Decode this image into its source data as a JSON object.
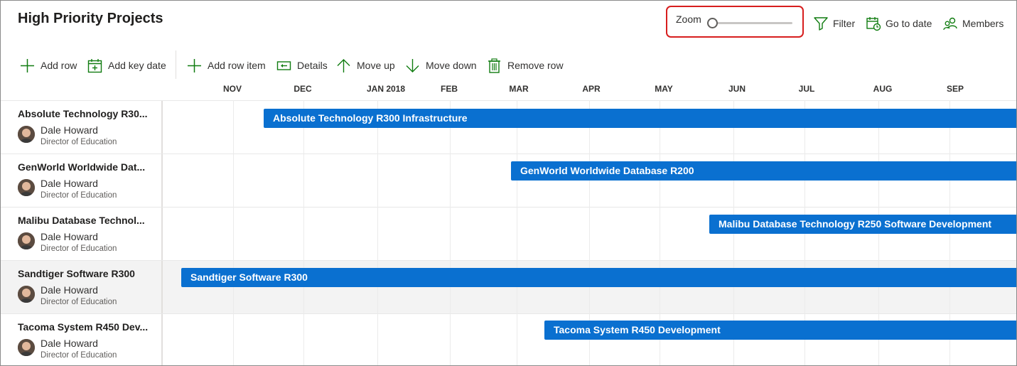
{
  "page": {
    "title": "High Priority Projects"
  },
  "zoom": {
    "label": "Zoom",
    "level": 0
  },
  "header_actions": {
    "filter": "Filter",
    "go_to_date": "Go to date",
    "members": "Members"
  },
  "toolbar": {
    "add_row": "Add row",
    "add_key_date": "Add key date",
    "add_row_item": "Add row item",
    "details": "Details",
    "move_up": "Move up",
    "move_down": "Move down",
    "remove_row": "Remove row"
  },
  "timeline": {
    "months": [
      "NOV",
      "DEC",
      "JAN 2018",
      "FEB",
      "MAR",
      "APR",
      "MAY",
      "JUN",
      "JUL",
      "AUG",
      "SEP"
    ]
  },
  "rows": [
    {
      "name": "Absolute Technology R30...",
      "person": "Dale Howard",
      "role": "Director of Education",
      "bar_label": "Absolute Technology R300 Infrastructure"
    },
    {
      "name": "GenWorld Worldwide Dat...",
      "person": "Dale Howard",
      "role": "Director of Education",
      "bar_label": "GenWorld Worldwide Database R200"
    },
    {
      "name": "Malibu Database Technol...",
      "person": "Dale Howard",
      "role": "Director of Education",
      "bar_label": "Malibu Database Technology R250 Software Development"
    },
    {
      "name": "Sandtiger Software R300",
      "person": "Dale Howard",
      "role": "Director of Education",
      "bar_label": "Sandtiger Software R300",
      "selected": true
    },
    {
      "name": "Tacoma System R450 Dev...",
      "person": "Dale Howard",
      "role": "Director of Education",
      "bar_label": "Tacoma System R450 Development"
    }
  ],
  "colors": {
    "bar": "#0a70d0",
    "zoom_highlight": "#d71e1e",
    "icon_green": "#107c10"
  }
}
